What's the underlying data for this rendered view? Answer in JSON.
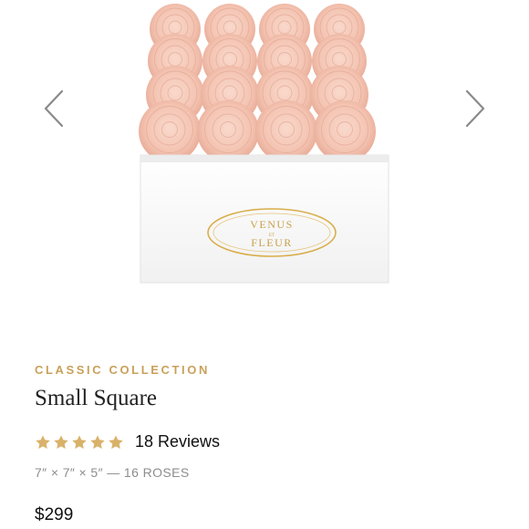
{
  "carousel": {
    "prev_icon": "chevron-left-icon",
    "next_icon": "chevron-right-icon",
    "box_brand": {
      "line1": "VENUS",
      "line2": "ET",
      "line3": "FLEUR"
    },
    "colors": {
      "rose": "#f6c8b6",
      "box": "#fbfbfb",
      "gold": "#d9ae4a"
    }
  },
  "product": {
    "collection": "CLASSIC COLLECTION",
    "name": "Small Square",
    "rating": {
      "stars": 5,
      "max": 5,
      "reviews_label": "18 Reviews"
    },
    "dimensions": "7″ × 7″ × 5″ — 16 ROSES",
    "price": "$299"
  },
  "colors": {
    "accent_gold": "#c9a15a",
    "star": "#d9b26a"
  }
}
